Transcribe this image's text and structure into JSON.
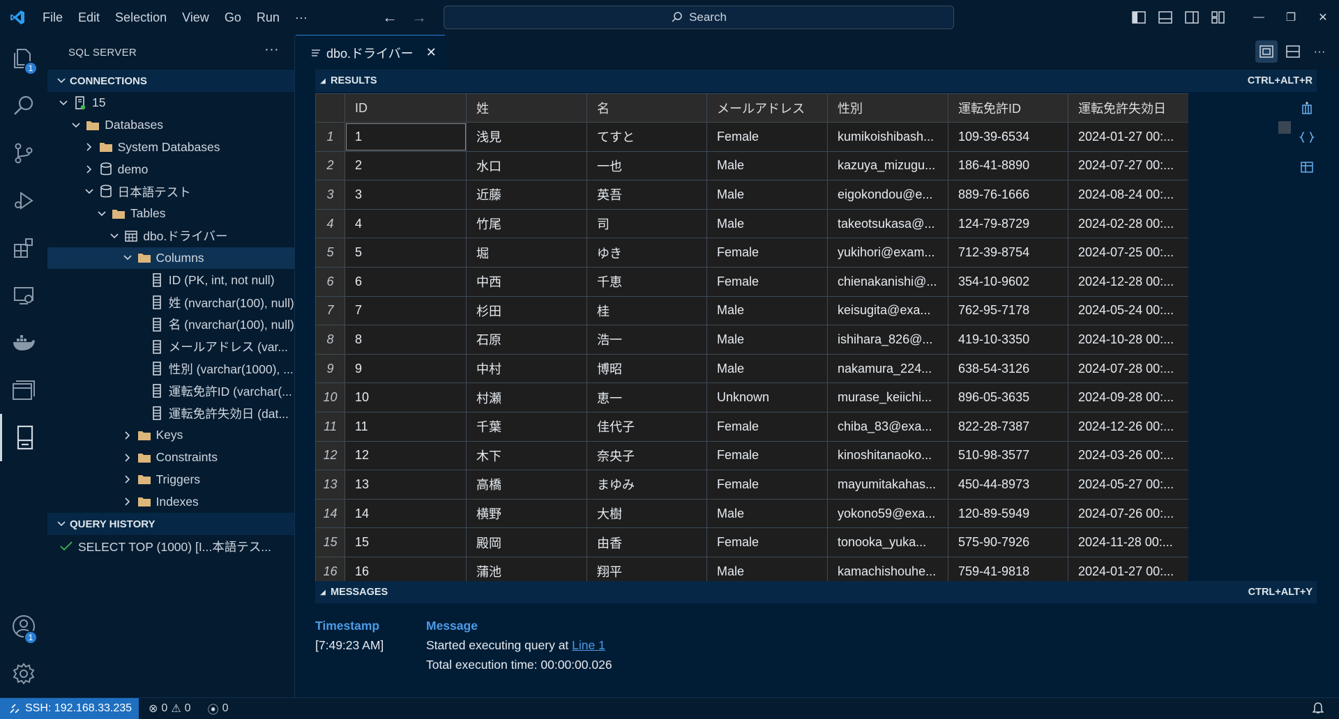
{
  "menu": [
    "File",
    "Edit",
    "Selection",
    "View",
    "Go",
    "Run",
    "···"
  ],
  "search": {
    "label": "Search"
  },
  "activity": {
    "explorer_badge": "1",
    "accounts_badge": "1"
  },
  "sidebar": {
    "title": "SQL SERVER",
    "more": "···",
    "connections_title": "CONNECTIONS",
    "tree": [
      {
        "label": "15",
        "level": 0,
        "twisty": "down",
        "icon": "server-icon"
      },
      {
        "label": "Databases",
        "level": 1,
        "twisty": "down",
        "icon": "folder-icon"
      },
      {
        "label": "System Databases",
        "level": 2,
        "twisty": "right",
        "icon": "folder-icon"
      },
      {
        "label": "demo",
        "level": 2,
        "twisty": "right",
        "icon": "database-icon"
      },
      {
        "label": "日本語テスト",
        "level": 2,
        "twisty": "down",
        "icon": "database-icon"
      },
      {
        "label": "Tables",
        "level": 3,
        "twisty": "down",
        "icon": "folder-icon"
      },
      {
        "label": "dbo.ドライバー",
        "level": 4,
        "twisty": "down",
        "icon": "table-icon"
      },
      {
        "label": "Columns",
        "level": 5,
        "twisty": "down",
        "icon": "folder-icon",
        "selected": true
      },
      {
        "label": "ID (PK, int, not null)",
        "level": 6,
        "twisty": "",
        "icon": "column-icon"
      },
      {
        "label": "姓 (nvarchar(100), null)",
        "level": 6,
        "twisty": "",
        "icon": "column-icon"
      },
      {
        "label": "名 (nvarchar(100), null)",
        "level": 6,
        "twisty": "",
        "icon": "column-icon"
      },
      {
        "label": "メールアドレス (var...",
        "level": 6,
        "twisty": "",
        "icon": "column-icon"
      },
      {
        "label": "性別 (varchar(1000), ...",
        "level": 6,
        "twisty": "",
        "icon": "column-icon"
      },
      {
        "label": "運転免許ID (varchar(...",
        "level": 6,
        "twisty": "",
        "icon": "column-icon"
      },
      {
        "label": "運転免許失効日 (dat...",
        "level": 6,
        "twisty": "",
        "icon": "column-icon"
      },
      {
        "label": "Keys",
        "level": 5,
        "twisty": "right",
        "icon": "folder-icon"
      },
      {
        "label": "Constraints",
        "level": 5,
        "twisty": "right",
        "icon": "folder-icon"
      },
      {
        "label": "Triggers",
        "level": 5,
        "twisty": "right",
        "icon": "folder-icon"
      },
      {
        "label": "Indexes",
        "level": 5,
        "twisty": "right",
        "icon": "folder-icon"
      }
    ],
    "history_title": "QUERY HISTORY",
    "history": [
      {
        "label": "SELECT TOP (1000) [I...本語テス...",
        "status": "check-icon"
      }
    ]
  },
  "editor": {
    "tab_label": "dbo.ドライバー",
    "results_title": "RESULTS",
    "results_shortcut": "CTRL+ALT+R",
    "messages_title": "MESSAGES",
    "messages_shortcut": "CTRL+ALT+Y"
  },
  "grid": {
    "columns": [
      "ID",
      "姓",
      "名",
      "メールアドレス",
      "性別",
      "運転免許ID",
      "運転免許失効日"
    ],
    "rows": [
      [
        "1",
        "1",
        "浅見",
        "てすと",
        "Female",
        "kumikoishibash...",
        "109-39-6534",
        "2024-01-27 00:..."
      ],
      [
        "2",
        "2",
        "水口",
        "一也",
        "Male",
        "kazuya_mizugu...",
        "186-41-8890",
        "2024-07-27 00:..."
      ],
      [
        "3",
        "3",
        "近藤",
        "英吾",
        "Male",
        "eigokondou@e...",
        "889-76-1666",
        "2024-08-24 00:..."
      ],
      [
        "4",
        "4",
        "竹尾",
        "司",
        "Male",
        "takeotsukasa@...",
        "124-79-8729",
        "2024-02-28 00:..."
      ],
      [
        "5",
        "5",
        "堀",
        "ゆき",
        "Female",
        "yukihori@exam...",
        "712-39-8754",
        "2024-07-25 00:..."
      ],
      [
        "6",
        "6",
        "中西",
        "千恵",
        "Female",
        "chienakanishi@...",
        "354-10-9602",
        "2024-12-28 00:..."
      ],
      [
        "7",
        "7",
        "杉田",
        "桂",
        "Male",
        "keisugita@exa...",
        "762-95-7178",
        "2024-05-24 00:..."
      ],
      [
        "8",
        "8",
        "石原",
        "浩一",
        "Male",
        "ishihara_826@...",
        "419-10-3350",
        "2024-10-28 00:..."
      ],
      [
        "9",
        "9",
        "中村",
        "博昭",
        "Male",
        "nakamura_224...",
        "638-54-3126",
        "2024-07-28 00:..."
      ],
      [
        "10",
        "10",
        "村瀬",
        "恵一",
        "Unknown",
        "murase_keiichi...",
        "896-05-3635",
        "2024-09-28 00:..."
      ],
      [
        "11",
        "11",
        "千葉",
        "佳代子",
        "Female",
        "chiba_83@exa...",
        "822-28-7387",
        "2024-12-26 00:..."
      ],
      [
        "12",
        "12",
        "木下",
        "奈央子",
        "Female",
        "kinoshitanaoko...",
        "510-98-3577",
        "2024-03-26 00:..."
      ],
      [
        "13",
        "13",
        "高橋",
        "まゆみ",
        "Female",
        "mayumitakahas...",
        "450-44-8973",
        "2024-05-27 00:..."
      ],
      [
        "14",
        "14",
        "横野",
        "大樹",
        "Male",
        "yokono59@exa...",
        "120-89-5949",
        "2024-07-26 00:..."
      ],
      [
        "15",
        "15",
        "殿岡",
        "由香",
        "Female",
        "tonooka_yuka...",
        "575-90-7926",
        "2024-11-28 00:..."
      ],
      [
        "16",
        "16",
        "蒲池",
        "翔平",
        "Male",
        "kamachishouhe...",
        "759-41-9818",
        "2024-01-27 00:..."
      ]
    ]
  },
  "messages": {
    "timestamp_header": "Timestamp",
    "message_header": "Message",
    "timestamp": "[7:49:23 AM]",
    "line1_prefix": "Started executing query at ",
    "line1_link": "Line 1",
    "line2": "Total execution time: 00:00:00.026"
  },
  "status": {
    "remote": "SSH: 192.168.33.235",
    "errors": "0",
    "warnings": "0",
    "ports": "0"
  },
  "colors": {
    "accent": "#2a7fd5",
    "remote_bg": "#1e6fc0",
    "link": "#4e9ae6"
  }
}
